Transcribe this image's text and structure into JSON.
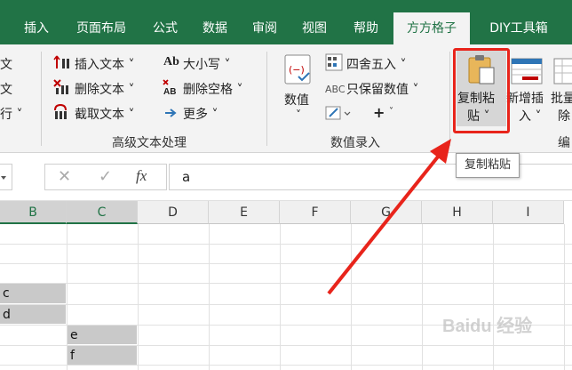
{
  "ribbon_tabs": [
    {
      "label": "插入"
    },
    {
      "label": "页面布局"
    },
    {
      "label": "公式"
    },
    {
      "label": "数据"
    },
    {
      "label": "审阅"
    },
    {
      "label": "视图"
    },
    {
      "label": "帮助"
    },
    {
      "label": "方方格子"
    },
    {
      "label": "DIY工具箱"
    }
  ],
  "ribbon": {
    "left_partial": [
      "文",
      "文",
      "行 ˅"
    ],
    "text_group": {
      "insert_text": "插入文本 ˅",
      "delete_text": "删除文本 ˅",
      "extract_text": "截取文本 ˅",
      "case": "大小写 ˅",
      "delete_spaces": "删除空格 ˅",
      "more": "更多 ˅",
      "label": "高级文本处理"
    },
    "number_group": {
      "value_btn": "数值",
      "value_chev": "˅",
      "round": "四舍五入 ˅",
      "keep_values": "只保留数值 ˅",
      "plus_label": "+",
      "label": "数值录入",
      "abc_tag": "ABC"
    },
    "copy_paste": {
      "line1": "复制粘",
      "line2": "贴 ˅"
    },
    "new_insert": {
      "line1": "新增插",
      "line2": "入 ˅"
    },
    "batch_delete": {
      "line1": "批量",
      "line2": "除"
    },
    "edit_partial": "编"
  },
  "formula_bar": {
    "value": "a",
    "fx": "fx",
    "cancel_glyph": "✕",
    "enter_glyph": "✓"
  },
  "tooltip": "复制粘贴",
  "columns": [
    "B",
    "C",
    "D",
    "E",
    "F",
    "G",
    "H",
    "I"
  ],
  "cells": {
    "c_partial": "c",
    "d_partial": "d",
    "e": "e",
    "f": "f"
  },
  "watermark": "Baidu 经验",
  "colors": {
    "excel_green": "#217346",
    "ribbon_bg": "#f3f3f3",
    "highlight_red": "#e8241b",
    "cell_selected": "#c9c9c9"
  }
}
